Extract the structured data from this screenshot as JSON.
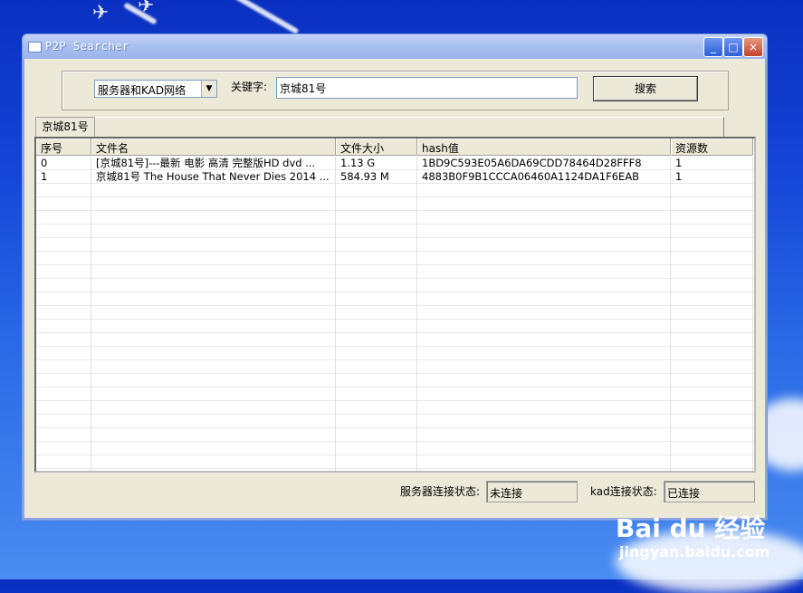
{
  "window": {
    "title": "P2P Searcher",
    "buttons": [
      "_",
      "□",
      "×"
    ]
  },
  "search": {
    "network_value": "服务器和KAD网络",
    "keyword_label": "关键字:",
    "keyword_value": "京城81号",
    "search_button": "搜索"
  },
  "tabs": [
    {
      "label": "京城81号"
    }
  ],
  "table": {
    "columns": [
      "序号",
      "文件名",
      "文件大小",
      "hash值",
      "资源数"
    ],
    "rows": [
      [
        "0",
        "[京城81号]---最新 电影 高清 完整版HD dvd ...",
        "1.13 G",
        "1BD9C593E05A6DA69CDD78464D28FFF8",
        "1"
      ],
      [
        "1",
        "京城81号 The House That Never Dies 2014 ...",
        "584.93 M",
        "4883B0F9B1CCCA06460A1124DA1F6EAB",
        "1"
      ]
    ]
  },
  "status": {
    "server_label": "服务器连接状态:",
    "server_value": "未连接",
    "kad_label": "kad连接状态:",
    "kad_value": "已连接"
  },
  "watermark": {
    "brand": "Bai du 经验",
    "url": "jingyan.baidu.com"
  },
  "colors": {
    "desktop": "#1546d8",
    "window_bg": "#ece9d8",
    "titlebar": "#a8bff0"
  }
}
